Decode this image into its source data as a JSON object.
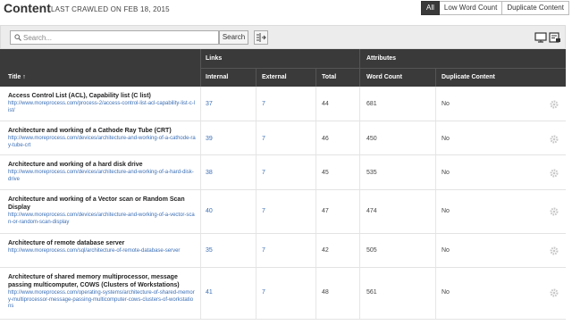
{
  "header": {
    "title": "Content",
    "crawled": "LAST CRAWLED ON FEB 18, 2015",
    "filters": [
      "All",
      "Low Word Count",
      "Duplicate Content"
    ]
  },
  "toolbar": {
    "search_placeholder": "Search...",
    "search_button": "Search"
  },
  "table": {
    "group_links": "Links",
    "group_attributes": "Attributes",
    "columns": [
      "Title ↑",
      "Internal",
      "External",
      "Total",
      "Word Count",
      "Duplicate Content"
    ],
    "rows": [
      {
        "title": "Access Control List (ACL), Capability list (C list)",
        "url": "http://www.moreprocess.com/process-2/access-control-list-acl-capability-list-c-list/",
        "internal": "37",
        "external": "7",
        "total": "44",
        "words": "681",
        "dup": "No"
      },
      {
        "title": "Architecture and working of a Cathode Ray Tube (CRT)",
        "url": "http://www.moreprocess.com/devices/architecture-and-working-of-a-cathode-ray-tube-crt",
        "internal": "39",
        "external": "7",
        "total": "46",
        "words": "450",
        "dup": "No"
      },
      {
        "title": "Architecture and working of a hard disk drive",
        "url": "http://www.moreprocess.com/devices/architecture-and-working-of-a-hard-disk-drive",
        "internal": "38",
        "external": "7",
        "total": "45",
        "words": "535",
        "dup": "No"
      },
      {
        "title": "Architecture and working of a Vector scan or Random Scan Display",
        "url": "http://www.moreprocess.com/devices/architecture-and-working-of-a-vector-scan-or-random-scan-display",
        "internal": "40",
        "external": "7",
        "total": "47",
        "words": "474",
        "dup": "No"
      },
      {
        "title": "Architecture of remote database server",
        "url": "http://www.moreprocess.com/sql/architecture-of-remote-database-server",
        "internal": "35",
        "external": "7",
        "total": "42",
        "words": "505",
        "dup": "No"
      },
      {
        "title": "Architecture of shared memory multiprocessor, message passing multicomputer, COWS (Clusters of Workstations)",
        "url": "http://www.moreprocess.com/operating-systems/architecture-of-shared-memory-multiprocessor-message-passing-multicomputer-cows-clusters-of-workstations",
        "internal": "41",
        "external": "7",
        "total": "48",
        "words": "561",
        "dup": "No"
      }
    ]
  },
  "colors": {
    "header_bg": "#3a3a3a",
    "link": "#3b6fb6",
    "toolbar_bg": "#ececec"
  },
  "icons": [
    "search-icon",
    "columns-icon",
    "monitor-icon",
    "export-icon",
    "gear-icon"
  ]
}
